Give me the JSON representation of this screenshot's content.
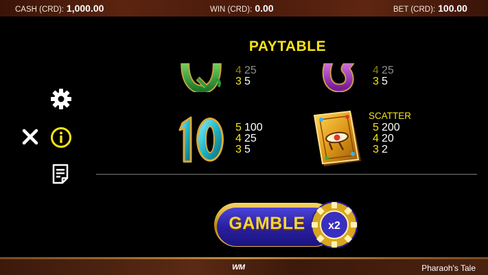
{
  "topbar": {
    "cash": {
      "label": "CASH (CRD):",
      "value": "1,000.00"
    },
    "win": {
      "label": "WIN (CRD):",
      "value": "0.00"
    },
    "bet": {
      "label": "BET (CRD):",
      "value": "100.00"
    }
  },
  "title": "PAYTABLE",
  "menu": {
    "settings_icon": "gear-icon",
    "close_icon": "close-icon",
    "info_icon": "info-icon",
    "history_icon": "notes-icon"
  },
  "paytable": {
    "symbol_q": {
      "icon": "green-q-symbol",
      "rows": [
        {
          "count": "4",
          "amount": "25"
        },
        {
          "count": "3",
          "amount": "5"
        }
      ]
    },
    "symbol_s": {
      "icon": "purple-snake-symbol",
      "rows": [
        {
          "count": "4",
          "amount": "25"
        },
        {
          "count": "3",
          "amount": "5"
        }
      ]
    },
    "symbol_10": {
      "icon": "teal-10-symbol",
      "rows": [
        {
          "count": "5",
          "amount": "100"
        },
        {
          "count": "4",
          "amount": "25"
        },
        {
          "count": "3",
          "amount": "5"
        }
      ]
    },
    "symbol_book": {
      "icon": "book-scatter-symbol",
      "label": "SCATTER",
      "rows": [
        {
          "count": "5",
          "amount": "200"
        },
        {
          "count": "4",
          "amount": "20"
        },
        {
          "count": "3",
          "amount": "2"
        }
      ]
    }
  },
  "gamble": {
    "label": "GAMBLE",
    "chip_text": "x2"
  },
  "footer": {
    "logo": "WM",
    "game_name": "Pharaoh's Tale"
  },
  "colors": {
    "accent_yellow": "#f7e317",
    "gamble_blue": "#2a1fa0",
    "background": "#000000"
  }
}
